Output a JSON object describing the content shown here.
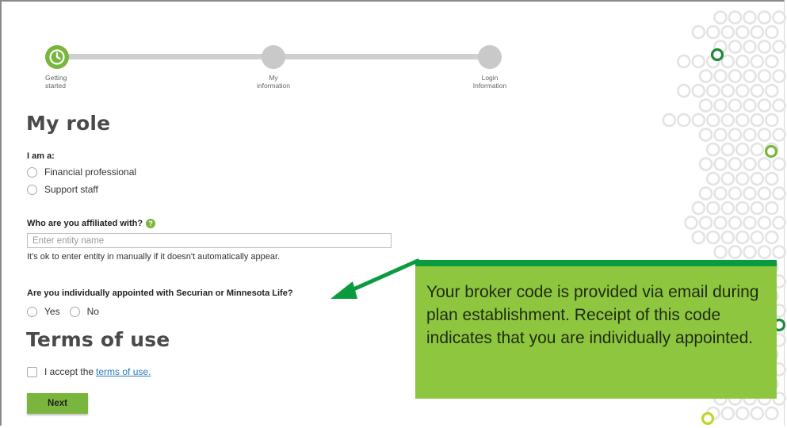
{
  "stepper": {
    "steps": [
      {
        "label_line1": "Getting",
        "label_line2": "started",
        "state": "active"
      },
      {
        "label_line1": "My",
        "label_line2": "information",
        "state": "pending"
      },
      {
        "label_line1": "Login",
        "label_line2": "Information",
        "state": "pending"
      }
    ]
  },
  "role": {
    "heading": "My role",
    "question": "I am a:",
    "options": [
      "Financial professional",
      "Support staff"
    ]
  },
  "affiliation": {
    "question": "Who are you affiliated with?",
    "help_icon": "question-icon",
    "placeholder": "Enter entity name",
    "hint": "It's ok to enter entity in manually if it doesn't automatically appear."
  },
  "appointment": {
    "question": "Are you individually appointed with Securian or Minnesota Life?",
    "options": [
      "Yes",
      "No"
    ]
  },
  "terms": {
    "heading": "Terms of use",
    "accept_prefix": "I accept the",
    "link_text": "terms of use."
  },
  "actions": {
    "next_label": "Next"
  },
  "callout": {
    "text": "Your broker code is provided via email during plan establishment. Receipt of this code indicates that you are individually appointed."
  },
  "colors": {
    "accent_green": "#7ab63d",
    "callout_green": "#8ec73f",
    "arrow_green": "#0a9b3e",
    "link_blue": "#2a7bbd"
  }
}
